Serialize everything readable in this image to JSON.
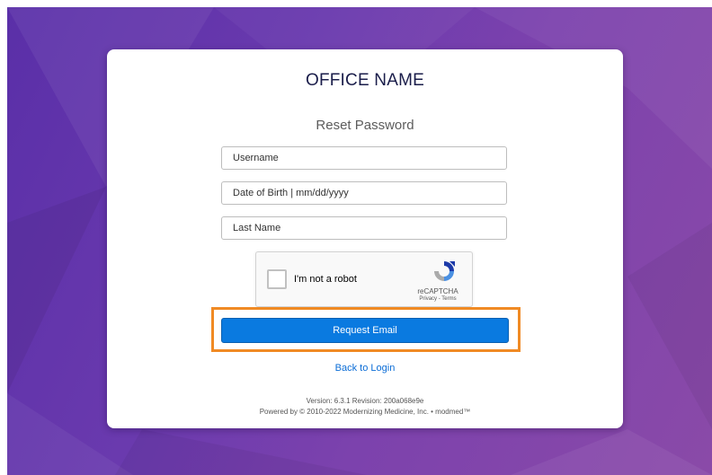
{
  "card": {
    "office_name": "OFFICE NAME",
    "subtitle": "Reset Password"
  },
  "form": {
    "username_placeholder": "Username",
    "dob_placeholder": "Date of Birth | mm/dd/yyyy",
    "lastname_placeholder": "Last Name"
  },
  "recaptcha": {
    "label": "I'm not a robot",
    "brand": "reCAPTCHA",
    "links": "Privacy - Terms",
    "logo_icon": "recaptcha-logo-icon"
  },
  "actions": {
    "request_label": "Request Email",
    "back_label": "Back to Login"
  },
  "footer": {
    "version": "Version: 6.3.1 Revision: 200a068e9e",
    "powered": "Powered by © 2010-2022 Modernizing Medicine, Inc. • modmed™"
  },
  "colors": {
    "background_purple": "#6a3aae",
    "button_blue": "#0a7ae0",
    "link_blue": "#0a6cd6",
    "highlight_orange": "#f08a24"
  }
}
